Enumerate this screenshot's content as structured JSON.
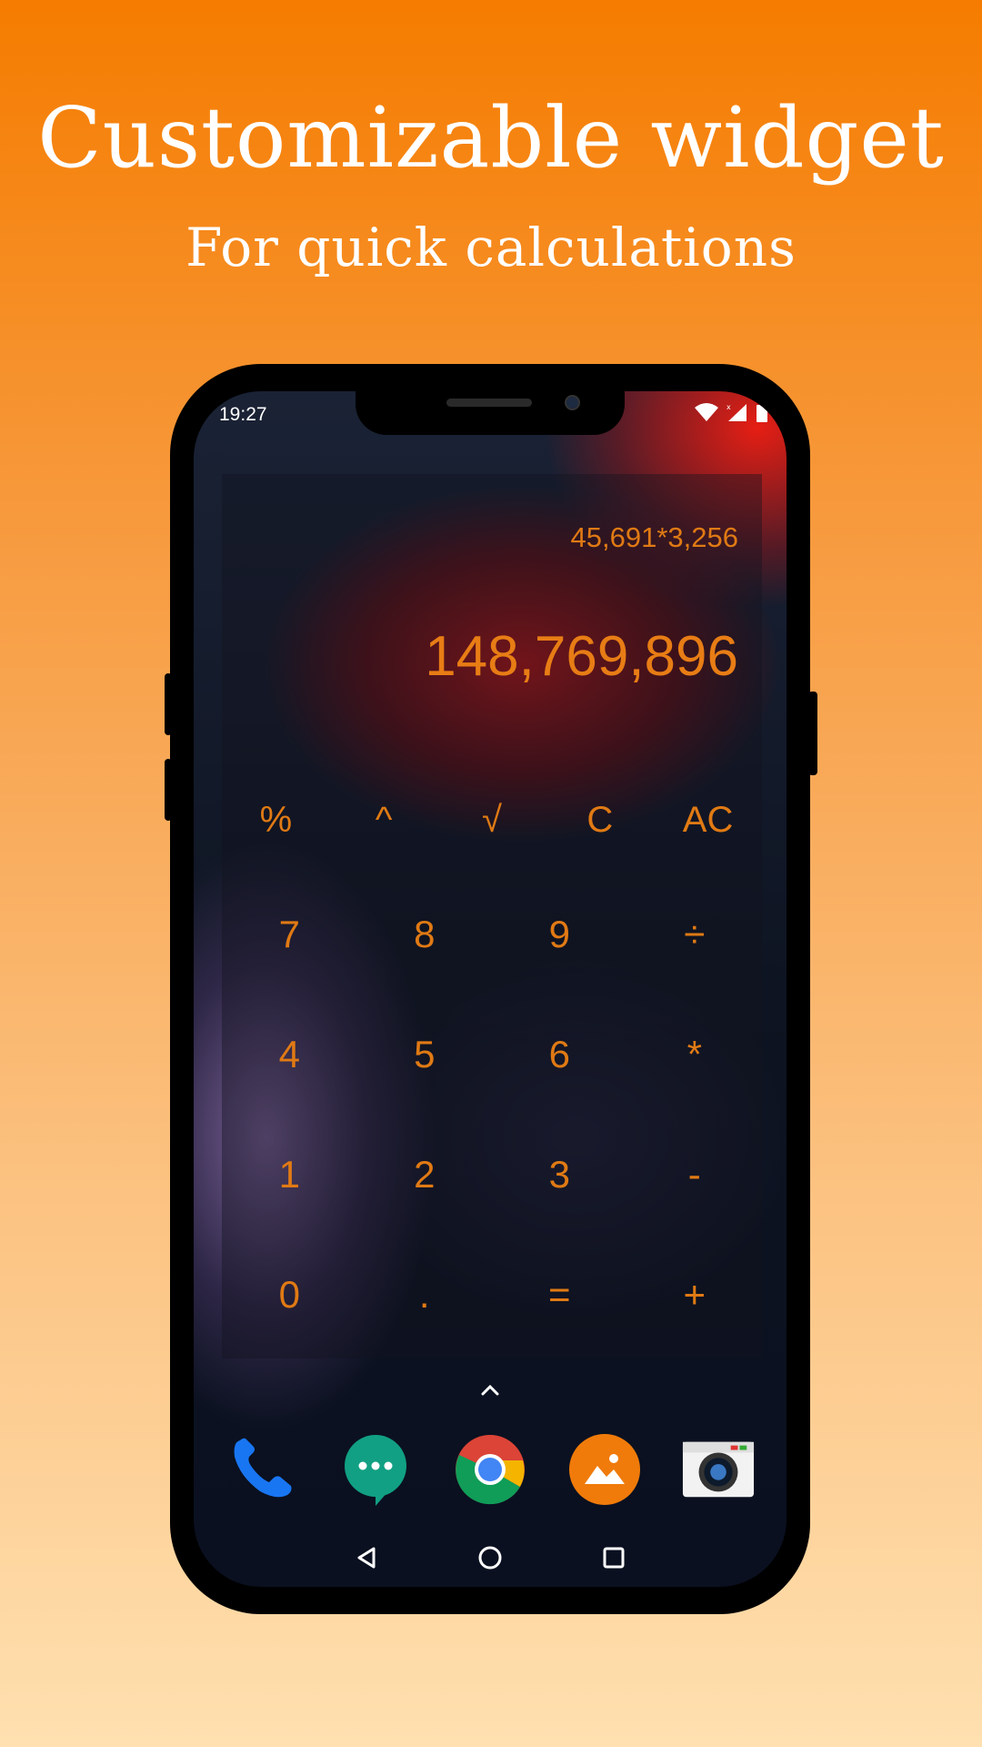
{
  "headline": {
    "title": "Customizable widget",
    "subtitle": "For quick calculations"
  },
  "status_bar": {
    "time": "19:27",
    "icons": [
      "wifi-icon",
      "signal-icon",
      "battery-icon"
    ]
  },
  "calculator_widget": {
    "expression": "45,691*3,256",
    "result": "148,769,896",
    "function_keys": [
      "%",
      "^",
      "√",
      "C",
      "AC"
    ],
    "keypad_rows": [
      [
        "7",
        "8",
        "9",
        "÷"
      ],
      [
        "4",
        "5",
        "6",
        "*"
      ],
      [
        "1",
        "2",
        "3",
        "-"
      ],
      [
        "0",
        ".",
        "=",
        "+"
      ]
    ],
    "accent_color": "#e87d15"
  },
  "dock": {
    "apps": [
      "phone-app-icon",
      "messages-app-icon",
      "chrome-app-icon",
      "gallery-app-icon",
      "camera-app-icon"
    ]
  },
  "navigation": [
    "back-button",
    "home-button",
    "recents-button"
  ],
  "colors": {
    "background_top": "#f57c00",
    "background_bottom": "#ffe0b0",
    "text_primary": "#ffffff"
  }
}
